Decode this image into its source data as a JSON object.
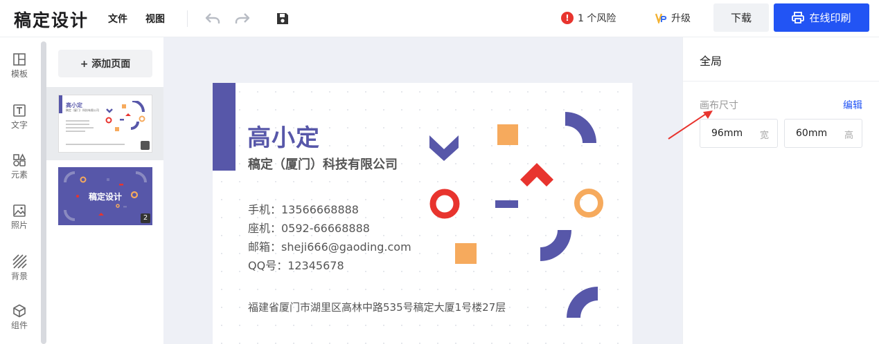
{
  "header": {
    "app_title": "稿定设计",
    "menu_file": "文件",
    "menu_view": "视图",
    "risk_count": "1",
    "risk_label": "1 个风险",
    "upgrade_label": "升级",
    "download_label": "下载",
    "print_label": "在线印刷"
  },
  "sidebar": {
    "items": [
      {
        "label": "模板",
        "icon": "template-icon"
      },
      {
        "label": "文字",
        "icon": "text-icon"
      },
      {
        "label": "元素",
        "icon": "elements-icon"
      },
      {
        "label": "照片",
        "icon": "photo-icon"
      },
      {
        "label": "背景",
        "icon": "background-icon"
      },
      {
        "label": "组件",
        "icon": "component-icon"
      }
    ]
  },
  "pages": {
    "add_label": "+ 添加页面",
    "thumb1": {
      "name": "高小定",
      "company": "稿定（厦门）科技有限公司"
    },
    "thumb2": {
      "title": "稿定设计",
      "page_number": "2"
    }
  },
  "card": {
    "name": "高小定",
    "company": "稿定（厦门）科技有限公司",
    "phone": "手机：13566668888",
    "landline": "座机：0592-66668888",
    "email": "邮箱：sheji666@gaoding.com",
    "qq": "QQ号：12345678",
    "address": "福建省厦门市湖里区高林中路535号稿定大厦1号楼27层"
  },
  "right_panel": {
    "title": "全局",
    "canvas_size_label": "画布尺寸",
    "edit_label": "编辑",
    "width_value": "96mm",
    "width_unit": "宽",
    "height_value": "60mm",
    "height_unit": "高"
  },
  "colors": {
    "brand_blue": "#2254f4",
    "card_purple": "#5757a9",
    "card_orange": "#f6aa5d",
    "card_red": "#e8342e"
  }
}
